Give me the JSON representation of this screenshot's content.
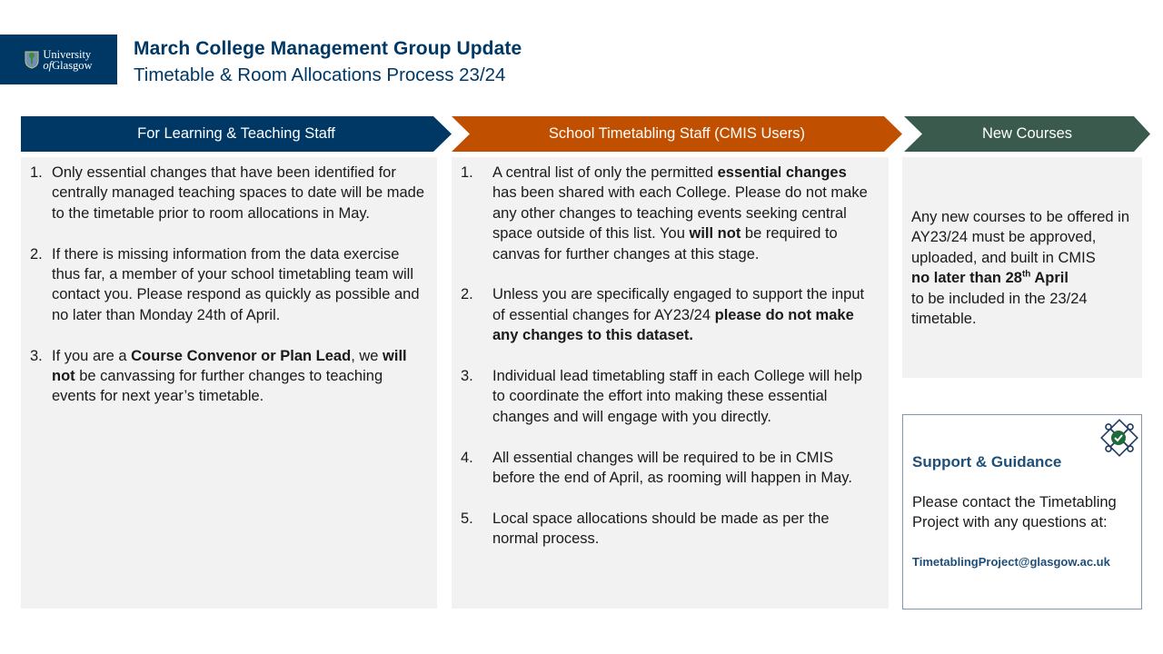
{
  "header": {
    "logo": {
      "line1": "University",
      "line2_prefix": "of",
      "line2": "Glasgow",
      "icon": "university-crest-icon"
    },
    "title": "March College Management Group Update",
    "subtitle": "Timetable & Room Allocations Process 23/24"
  },
  "colors": {
    "navy": "#003865",
    "orange": "#c05000",
    "green": "#3a5a4e",
    "panel_bg": "#f2f2f2",
    "link_blue": "#1f4e79"
  },
  "sections": [
    {
      "heading": "For Learning & Teaching Staff",
      "items": [
        {
          "num": "1.",
          "parts": [
            {
              "t": "Only essential changes that have been identified for centrally managed teaching spaces to date will be made to the timetable prior to room allocations in May."
            }
          ]
        },
        {
          "num": "2.",
          "parts": [
            {
              "t": "If there is missing information from the data exercise thus far, a member of your school timetabling team will contact you.  Please respond as quickly as possible and no later than Monday 24th of April."
            }
          ]
        },
        {
          "num": "3.",
          "parts": [
            {
              "t": "If you are a "
            },
            {
              "t": "Course Convenor or Plan Lead",
              "b": true
            },
            {
              "t": ", we "
            },
            {
              "t": "will not",
              "b": true
            },
            {
              "t": " be canvassing for further changes to teaching events for next year’s timetable."
            }
          ]
        }
      ]
    },
    {
      "heading": "School Timetabling Staff (CMIS Users)",
      "items": [
        {
          "num": "1.",
          "parts": [
            {
              "t": "A central list of only the permitted "
            },
            {
              "t": "essential changes",
              "b": true
            },
            {
              "t": " has been shared with each College. Please do not make any other changes to teaching events seeking central space outside of this list. You "
            },
            {
              "t": "will not",
              "b": true
            },
            {
              "t": " be required to canvas for further changes at this stage."
            }
          ]
        },
        {
          "num": "2.",
          "parts": [
            {
              "t": "Unless you are specifically engaged to support the input of essential changes for AY23/24 "
            },
            {
              "t": "please do not make any changes to this dataset.",
              "b": true
            }
          ]
        },
        {
          "num": "3.",
          "parts": [
            {
              "t": "Individual lead timetabling staff in each College will help to coordinate the effort into making these essential changes and will engage with you directly."
            }
          ]
        },
        {
          "num": "4.",
          "parts": [
            {
              "t": "All essential changes will be required to be in CMIS before the end of April, as rooming will happen in May."
            }
          ]
        },
        {
          "num": "5.",
          "parts": [
            {
              "t": "Local space allocations should be made as per the normal process."
            }
          ]
        }
      ]
    },
    {
      "heading": "New Courses",
      "text_before": "Any new courses to be offered in AY23/24 must be approved, uploaded, and built in CMIS",
      "bold_text": "no later than 28",
      "bold_sup": "th",
      "bold_after": " April",
      "text_after": "to be included in the 23/24 timetable."
    }
  ],
  "support": {
    "heading": "Support & Guidance",
    "body": "Please contact the Timetabling Project with any questions at:",
    "email": "TimetablingProject@glasgow.ac.uk",
    "icon": "puzzle-check-icon"
  }
}
